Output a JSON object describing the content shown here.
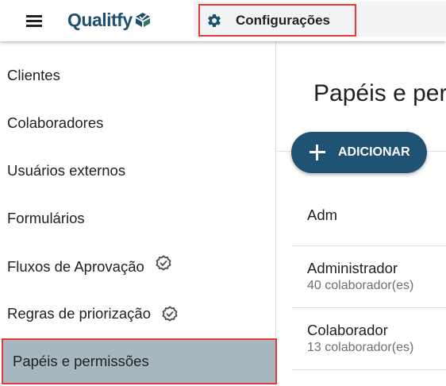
{
  "header": {
    "brand": "Qualitfy",
    "settings_label": "Configurações",
    "accent_color": "#1d4f6e",
    "highlight_color": "#e53935"
  },
  "sidebar": {
    "items": [
      {
        "label": "Clientes"
      },
      {
        "label": "Colaboradores"
      },
      {
        "label": "Usuários externos"
      },
      {
        "label": "Formulários"
      },
      {
        "label": "Fluxos de Aprovação",
        "icon": "verified-badge-icon"
      },
      {
        "label": "Regras de priorização",
        "icon": "verified-badge-icon"
      },
      {
        "label": "Papéis e permissões",
        "active": true
      }
    ]
  },
  "main": {
    "title": "Papéis e permissões",
    "add_button": "ADICIONAR",
    "roles": [
      {
        "name": "Adm",
        "count": ""
      },
      {
        "name": "Administrador",
        "count": "40 colaborador(es)"
      },
      {
        "name": "Colaborador",
        "count": "13 colaborador(es)"
      }
    ]
  }
}
